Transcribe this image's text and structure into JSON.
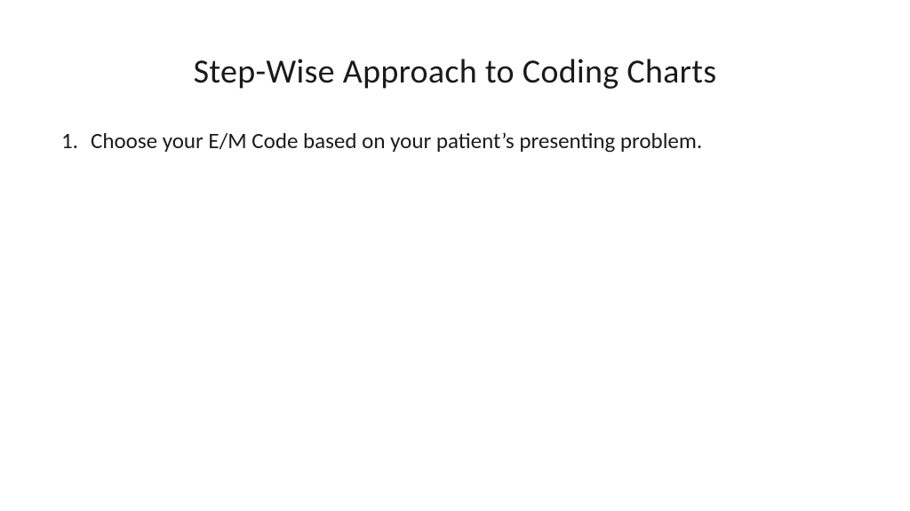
{
  "slide": {
    "title": "Step-Wise Approach to Coding Charts",
    "items": [
      {
        "number": "1.",
        "text": "Choose your E/M Code based on your patient’s presenting problem."
      }
    ]
  }
}
